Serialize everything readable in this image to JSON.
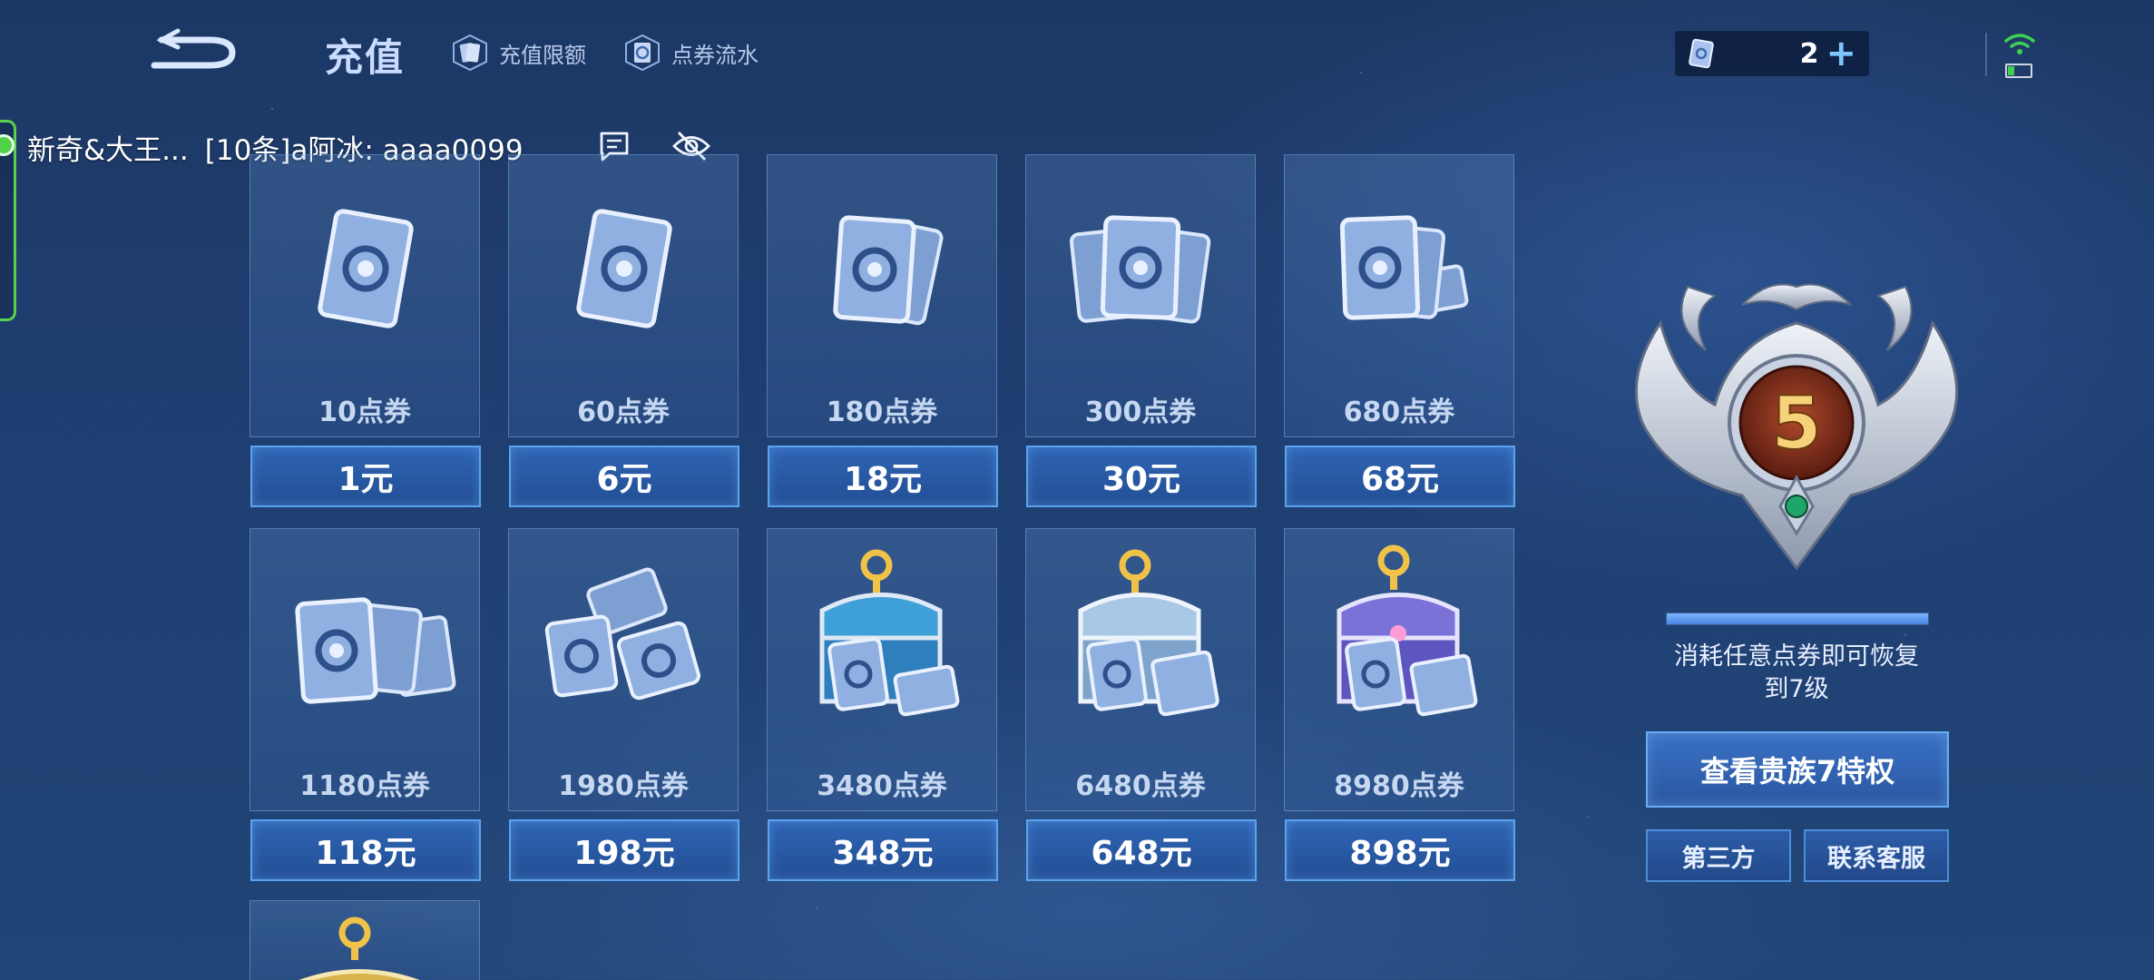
{
  "header": {
    "title": "充值",
    "limit_label": "充值限额",
    "flow_label": "点券流水",
    "balance": "2",
    "plus": "+"
  },
  "chat": {
    "group": "新奇&大王...",
    "message": "[10条]a阿冰: aaaa0099"
  },
  "packs": [
    {
      "points": "10点券",
      "price": "1元"
    },
    {
      "points": "60点券",
      "price": "6元"
    },
    {
      "points": "180点券",
      "price": "18元"
    },
    {
      "points": "300点券",
      "price": "30元"
    },
    {
      "points": "680点券",
      "price": "68元"
    },
    {
      "points": "1180点券",
      "price": "118元"
    },
    {
      "points": "1980点券",
      "price": "198元"
    },
    {
      "points": "3480点券",
      "price": "348元"
    },
    {
      "points": "6480点券",
      "price": "648元"
    },
    {
      "points": "8980点券",
      "price": "898元"
    }
  ],
  "noble": {
    "level": "5",
    "progress": 1.0,
    "notice_line1": "消耗任意点券即可恢复",
    "notice_line2": "到7级",
    "privilege_button": "查看贵族7特权",
    "third_party_button": "第三方",
    "service_button": "联系客服"
  },
  "colors": {
    "accent": "#5aa3f0",
    "status_green": "#51d147",
    "background": "#1f3f72"
  }
}
